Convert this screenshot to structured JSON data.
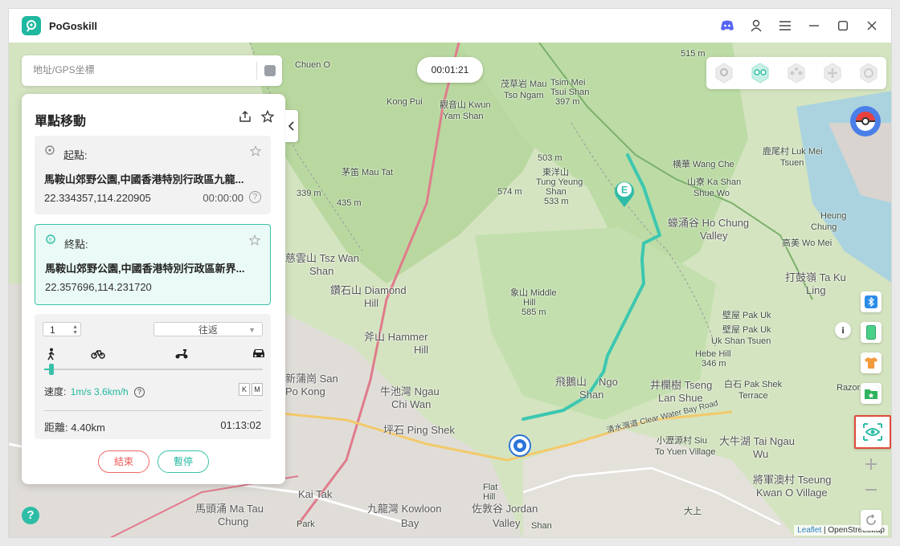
{
  "app": {
    "title": "PoGoskill"
  },
  "search": {
    "placeholder": "地址/GPS坐標"
  },
  "panel": {
    "title": "單點移動",
    "start": {
      "label": "起點:",
      "address": "馬鞍山郊野公園,中國香港特別行政區九龍...",
      "coords": "22.334357,114.220905",
      "time": "00:00:00"
    },
    "end": {
      "label": "終點:",
      "address": "馬鞍山郊野公園,中國香港特別行政區新界...",
      "coords": "22.357696,114.231720"
    },
    "repeat_count": "1",
    "mode": "往返",
    "speed_label": "速度:",
    "speed_value": "1m/s 3.6km/h",
    "speed_units": [
      "K",
      "M"
    ],
    "distance": "距離:  4.40km",
    "duration": "01:13:02",
    "end_button": "結束",
    "pause_button": "暫停"
  },
  "timer": "00:01:21",
  "attribution": {
    "leaflet": "Leaflet",
    "osm": "OpenStreetMap"
  },
  "colors": {
    "accent": "#1fb8a0",
    "route": "#3cc7b0",
    "danger": "#e55555"
  },
  "map_labels": [
    "Chuen O",
    "Kong Pui",
    "觀音山 Kwun",
    "Yam Shan",
    "茂草岩 Mau",
    "Tso Ngam",
    "Tsim Mei",
    "Tsui Shan",
    "397 m",
    "515 m",
    "503 m",
    "茅笛 Mau Tat",
    "東洋山",
    "Tung Yeung",
    "Shan",
    "533 m",
    "574 m",
    "339 m",
    "435 m",
    "慈雲山 Tsz Wan",
    "Shan",
    "鑽石山 Diamond",
    "Hill",
    "象山 Middle",
    "Hill",
    "585 m",
    "斧山 Hammer",
    "Hill",
    "新蒲崗 San",
    "Po Kong",
    "牛池灣 Ngau",
    "Chi Wan",
    "坪石 Ping Shek",
    "飛鵝山",
    "Ngo",
    "Shan",
    "横華 Wang Che",
    "山寮 Ka Shan",
    "Shue Wo",
    "蠔涌谷 Ho Chung",
    "Valley",
    "鹿尾村 Luk Mei",
    "Tsuen",
    "Heung",
    "Chung",
    "高美 Wo Mei",
    "打鼓嶺 Ta Ku",
    "Ling",
    "壁屋 Pak Uk",
    "壁屋 Pak Uk",
    "Uk Shan Tsuen",
    "Hebe Hill",
    "346 m",
    "井欄樹 Tseng",
    "Lan Shue",
    "白石 Pak Shek",
    "Terrace",
    "大牛湖 Tai Ngau",
    "Wu",
    "將軍澳村 Tseung",
    "Kwan O Village",
    "小瀝源村 Siu",
    "To Yuen Village",
    "Flat",
    "Hill",
    "佐敦谷 Jordan",
    "Valley",
    "Kai Tak",
    "Bay",
    "九龍灣 Kowloon",
    "馬頭涌 Ma Tau",
    "Chung",
    "Park",
    "Razor Hill",
    "Shan",
    "大上",
    "清水灣道 Clear Water Bay Road"
  ]
}
